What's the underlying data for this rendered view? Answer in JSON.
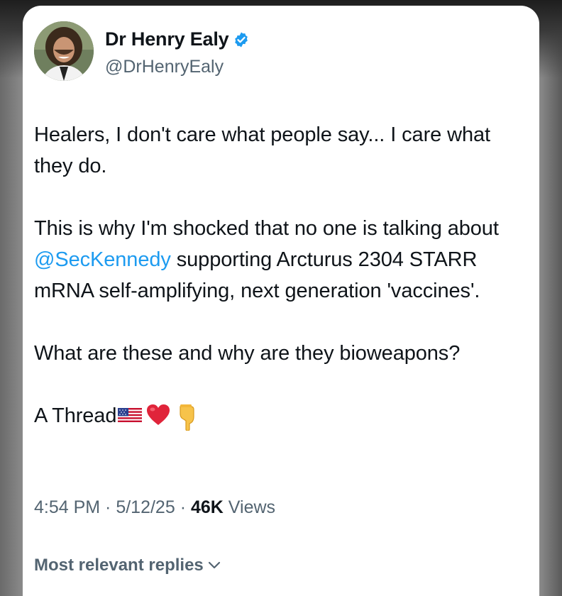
{
  "author": {
    "name": "Dr Henry Ealy",
    "handle": "@DrHenryEaly",
    "verified_color": "#1d9bf0"
  },
  "post": {
    "p1": "Healers, I don't care what people say... I care what they do.",
    "p2_before": "This is why I'm shocked that no one is talking about ",
    "p2_mention": "@SecKennedy",
    "p2_after": " supporting Arcturus 2304 STARR mRNA self-amplifying, next generation 'vaccines'.",
    "p3": "What are these and why are they bioweapons?",
    "p4": "A Thread",
    "emojis": [
      "us-flag-icon",
      "red-heart-icon",
      "pointing-down-icon"
    ]
  },
  "meta": {
    "time": "4:54 PM",
    "sep1": " · ",
    "date": "5/12/25",
    "sep2": " · ",
    "views_count": "46K",
    "views_label": " Views"
  },
  "replies": {
    "label": "Most relevant replies"
  },
  "colors": {
    "text": "#0f1419",
    "secondary": "#536471",
    "link": "#1d9bf0"
  }
}
